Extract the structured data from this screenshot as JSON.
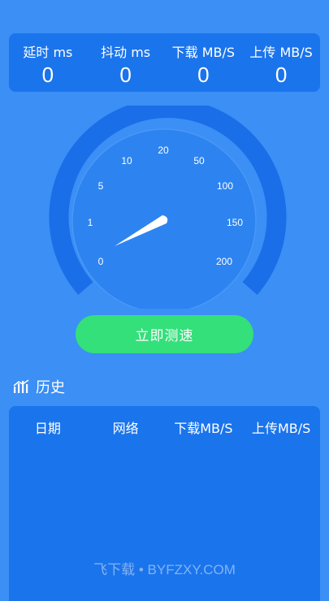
{
  "stats": [
    {
      "label": "延时  ms",
      "value": "0"
    },
    {
      "label": "抖动  ms",
      "value": "0"
    },
    {
      "label": "下载  MB/S",
      "value": "0"
    },
    {
      "label": "上传  MB/S",
      "value": "0"
    }
  ],
  "gauge": {
    "ticks": [
      "0",
      "1",
      "5",
      "10",
      "20",
      "50",
      "100",
      "150",
      "200"
    ]
  },
  "start_button_label": "立即测速",
  "history": {
    "title": "历史",
    "columns": [
      "日期",
      "网络",
      "下载MB/S",
      "上传MB/S"
    ]
  },
  "watermark": "飞下载 • BYFZXY.COM",
  "colors": {
    "background": "#3b8ff5",
    "panel": "#1a74ec",
    "button": "#33e07a"
  }
}
